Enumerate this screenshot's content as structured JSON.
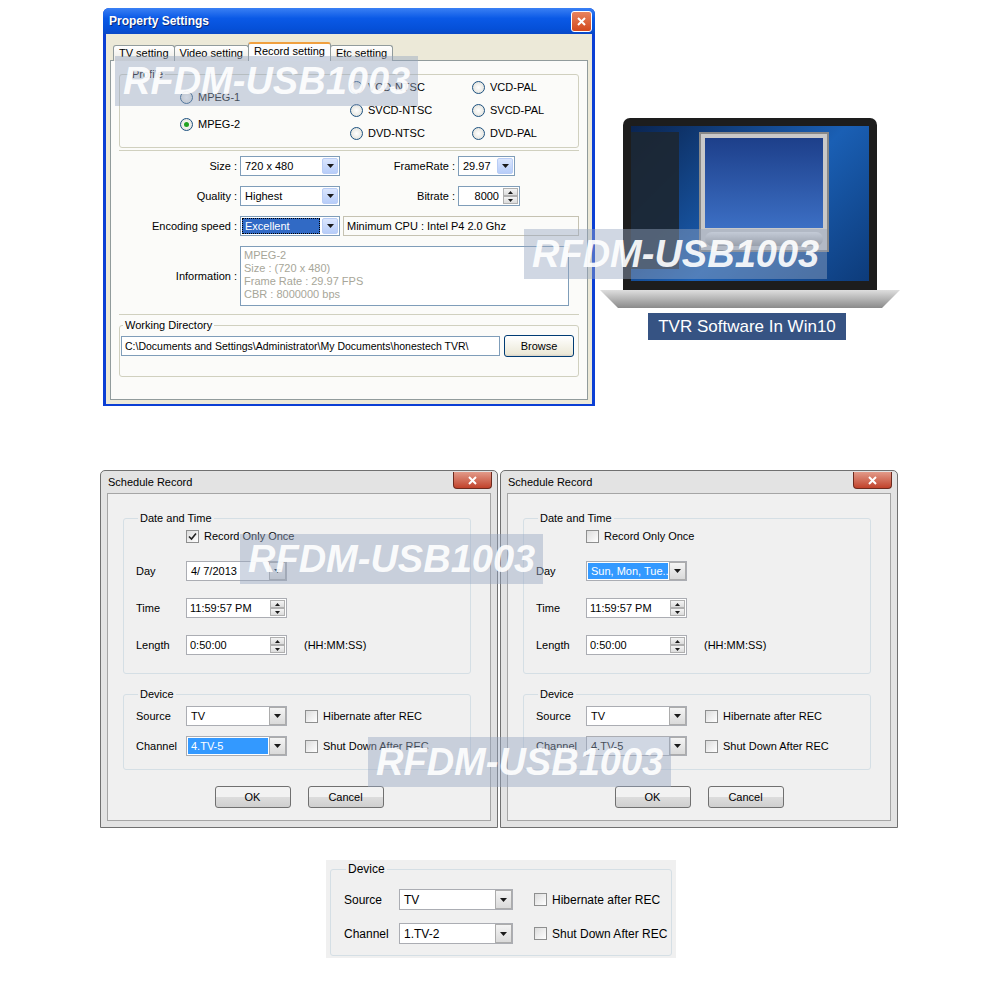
{
  "property_settings": {
    "title": "Property Settings",
    "tabs": [
      {
        "label": "TV setting",
        "selected": false
      },
      {
        "label": "Video setting",
        "selected": false
      },
      {
        "label": "Record setting",
        "selected": true
      },
      {
        "label": "Etc setting",
        "selected": false
      }
    ],
    "profile": {
      "label": "Profile",
      "options": [
        {
          "label": "MPEG-1",
          "selected": false
        },
        {
          "label": "MPEG-2",
          "selected": true
        },
        {
          "label": "VCD-NTSC",
          "selected": false
        },
        {
          "label": "SVCD-NTSC",
          "selected": false
        },
        {
          "label": "DVD-NTSC",
          "selected": false
        },
        {
          "label": "VCD-PAL",
          "selected": false
        },
        {
          "label": "SVCD-PAL",
          "selected": false
        },
        {
          "label": "DVD-PAL",
          "selected": false
        }
      ]
    },
    "size": {
      "label": "Size :",
      "value": "720 x 480",
      "selected": false
    },
    "frame_rate": {
      "label": "FrameRate :",
      "value": "29.97",
      "selected": false
    },
    "quality": {
      "label": "Quality :",
      "value": "Highest",
      "selected": false
    },
    "bitrate": {
      "label": "Bitrate :",
      "value": "8000"
    },
    "encoding_speed": {
      "label": "Encoding speed :",
      "value": "Excellent",
      "selected": true,
      "note": "Minimum CPU : Intel P4 2.0 Ghz"
    },
    "information": {
      "label": "Information :",
      "disabled": true,
      "lines": [
        "MPEG-2",
        "Size : (720 x 480)",
        "Frame Rate : 29.97 FPS",
        "CBR : 8000000 bps"
      ]
    },
    "working_directory": {
      "label": "Working Directory",
      "path": "C:\\Documents and Settings\\Administrator\\My Documents\\honestech TVR\\",
      "button": "Browse"
    }
  },
  "laptop": {
    "caption": "TVR Software In Win10"
  },
  "schedule_dialogs": [
    {
      "title": "Schedule Record",
      "date_group": "Date and Time",
      "record_once": {
        "label": "Record Only Once",
        "checked": true
      },
      "day": {
        "label": "Day",
        "value": "4/ 7/2013",
        "selected": false
      },
      "time": {
        "label": "Time",
        "value": "11:59:57 PM"
      },
      "length": {
        "label": "Length",
        "value": "0:50:00",
        "hint": "(HH:MM:SS)"
      },
      "device_group": "Device",
      "source": {
        "label": "Source",
        "value": "TV",
        "selected": false
      },
      "channel": {
        "label": "Channel",
        "value": "4.TV-5",
        "selected": true
      },
      "hibernate": {
        "label": "Hibernate after REC",
        "checked": false
      },
      "shutdown": {
        "label": "Shut Down After REC",
        "checked": false
      },
      "buttons": [
        "OK",
        "Cancel"
      ]
    },
    {
      "title": "Schedule Record",
      "date_group": "Date and Time",
      "record_once": {
        "label": "Record Only Once",
        "checked": false
      },
      "day": {
        "label": "Day",
        "value": "Sun, Mon, Tue...",
        "selected": true
      },
      "time": {
        "label": "Time",
        "value": "11:59:57 PM"
      },
      "length": {
        "label": "Length",
        "value": "0:50:00",
        "hint": "(HH:MM:SS)"
      },
      "device_group": "Device",
      "source": {
        "label": "Source",
        "value": "TV",
        "selected": false
      },
      "channel": {
        "label": "Channel",
        "value": "4.TV-5",
        "selected": false
      },
      "hibernate": {
        "label": "Hibernate after REC",
        "checked": false
      },
      "shutdown": {
        "label": "Shut Down After REC",
        "checked": false
      },
      "buttons": [
        "OK",
        "Cancel"
      ]
    }
  ],
  "device_panel": {
    "label": "Device",
    "source": {
      "label": "Source",
      "value": "TV",
      "selected": false
    },
    "channel": {
      "label": "Channel",
      "value": "1.TV-2",
      "selected": false
    },
    "hibernate": {
      "label": "Hibernate after REC",
      "checked": false
    },
    "shutdown": {
      "label": "Shut Down After REC",
      "checked": false
    }
  },
  "watermarks": [
    {
      "text": "RFDM-USB1003"
    },
    {
      "text": "RFDM-USB1003"
    },
    {
      "text": "RFDM-USB1003"
    },
    {
      "text": "RFDM-USB1003"
    }
  ]
}
